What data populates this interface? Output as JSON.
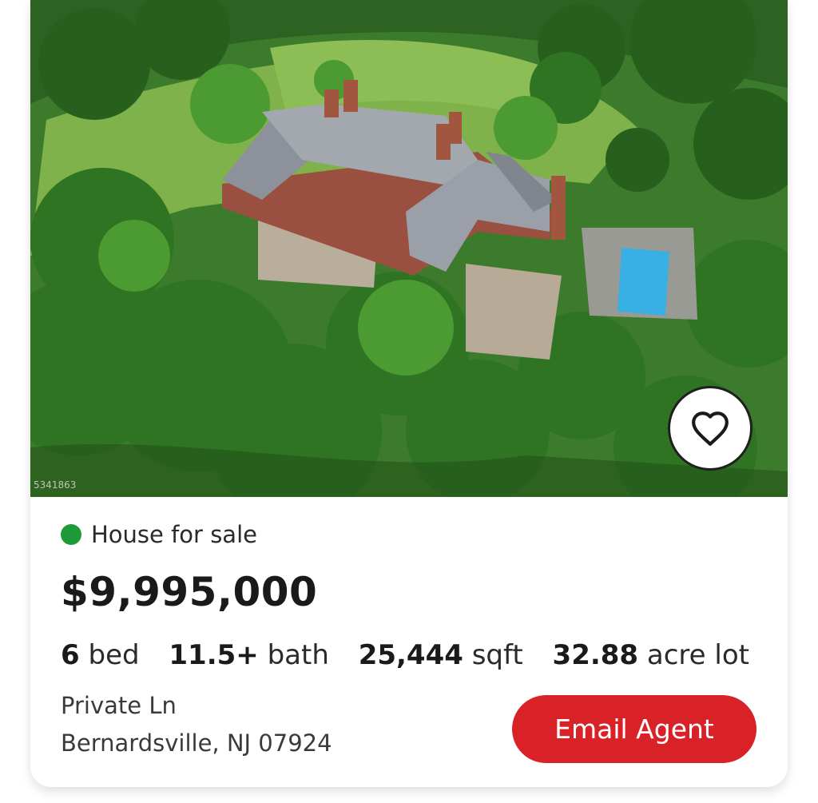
{
  "listing": {
    "mls_id": "5341863",
    "status": "House for sale",
    "status_color": "#1e9a3a",
    "price": "$9,995,000",
    "specs": [
      {
        "value": "6",
        "unit": "bed"
      },
      {
        "value": "11.5+",
        "unit": "bath"
      },
      {
        "value": "25,444",
        "unit": "sqft"
      },
      {
        "value": "32.88",
        "unit": "acre lot"
      }
    ],
    "address_line1": "Private Ln",
    "address_line2": "Bernardsville, NJ 07924",
    "favorite_icon": "heart-outline-icon"
  },
  "actions": {
    "email_agent_label": "Email Agent",
    "accent_color": "#d92228"
  }
}
